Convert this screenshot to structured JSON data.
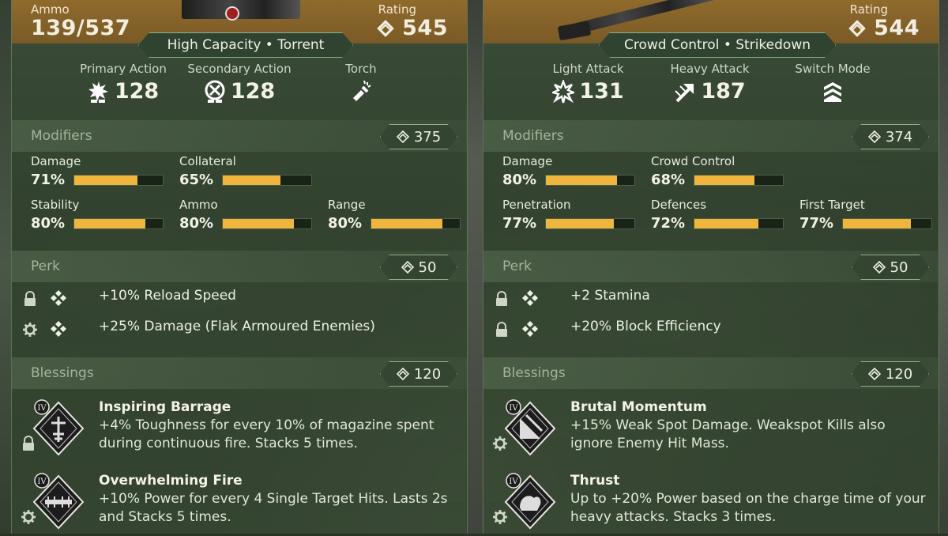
{
  "left": {
    "ammo_label": "Ammo",
    "ammo_value": "139/537",
    "rating_label": "Rating",
    "rating_value": "545",
    "banner": "High Capacity • Torrent",
    "actions": [
      {
        "label": "Primary Action",
        "value": "128",
        "icon": "burst-fire-icon"
      },
      {
        "label": "Secondary Action",
        "value": "128",
        "icon": "crosshair-icon"
      },
      {
        "label": "Torch",
        "value": "",
        "icon": "flashlight-icon"
      }
    ],
    "modifiers_title": "Modifiers",
    "modifiers_rating": "375",
    "modifiers": [
      {
        "name": "Damage",
        "pct": "71%",
        "fill": 0.71
      },
      {
        "name": "Collateral",
        "pct": "65%",
        "fill": 0.65
      },
      {
        "name": "Stability",
        "pct": "80%",
        "fill": 0.8
      },
      {
        "name": "Ammo",
        "pct": "80%",
        "fill": 0.8
      },
      {
        "name": "Range",
        "pct": "80%",
        "fill": 0.8
      }
    ],
    "perk_title": "Perk",
    "perk_rating": "50",
    "perks": [
      {
        "text": "+10% Reload Speed",
        "lead_icon": "lock-icon"
      },
      {
        "text": "+25% Damage (Flak Armoured Enemies)",
        "lead_icon": "gear-icon"
      }
    ],
    "blessings_title": "Blessings",
    "blessings_rating": "120",
    "blessings": [
      {
        "tier": "IV",
        "title": "Inspiring Barrage",
        "desc": "+4% Toughness for every 10% of magazine spent during continuous fire. Stacks 5 times.",
        "small_icon": "lock-icon"
      },
      {
        "tier": "IV",
        "title": "Overwhelming Fire",
        "desc": "+10% Power for every 4 Single Target Hits. Lasts 2s and Stacks 5 times.",
        "small_icon": "gear-icon"
      }
    ]
  },
  "right": {
    "rating_label": "Rating",
    "rating_value": "544",
    "banner": "Crowd Control • Strikedown",
    "actions": [
      {
        "label": "Light Attack",
        "value": "131",
        "icon": "light-attack-icon"
      },
      {
        "label": "Heavy Attack",
        "value": "187",
        "icon": "heavy-attack-icon"
      },
      {
        "label": "Switch Mode",
        "value": "",
        "icon": "chevron-stack-icon"
      }
    ],
    "modifiers_title": "Modifiers",
    "modifiers_rating": "374",
    "modifiers": [
      {
        "name": "Damage",
        "pct": "80%",
        "fill": 0.8
      },
      {
        "name": "Crowd Control",
        "pct": "68%",
        "fill": 0.68
      },
      {
        "name": "Penetration",
        "pct": "77%",
        "fill": 0.77
      },
      {
        "name": "Defences",
        "pct": "72%",
        "fill": 0.72
      },
      {
        "name": "First Target",
        "pct": "77%",
        "fill": 0.77
      }
    ],
    "perk_title": "Perk",
    "perk_rating": "50",
    "perks": [
      {
        "text": "+2 Stamina",
        "lead_icon": "lock-icon"
      },
      {
        "text": "+20% Block Efficiency",
        "lead_icon": "lock-icon"
      }
    ],
    "blessings_title": "Blessings",
    "blessings_rating": "120",
    "blessings": [
      {
        "tier": "IV",
        "title": "Brutal Momentum",
        "desc": "+15% Weak Spot Damage. Weakspot Kills also ignore Enemy Hit Mass.",
        "small_icon": "gear-icon"
      },
      {
        "tier": "IV",
        "title": "Thrust",
        "desc": "Up to +20% Power based on the charge time of your heavy attacks. Stacks 3 times.",
        "small_icon": "gear-icon"
      }
    ]
  },
  "colors": {
    "bar_fill": "#f0b53c",
    "header_bronze": "#8f6a2c",
    "panel_green": "#3a4e38"
  }
}
